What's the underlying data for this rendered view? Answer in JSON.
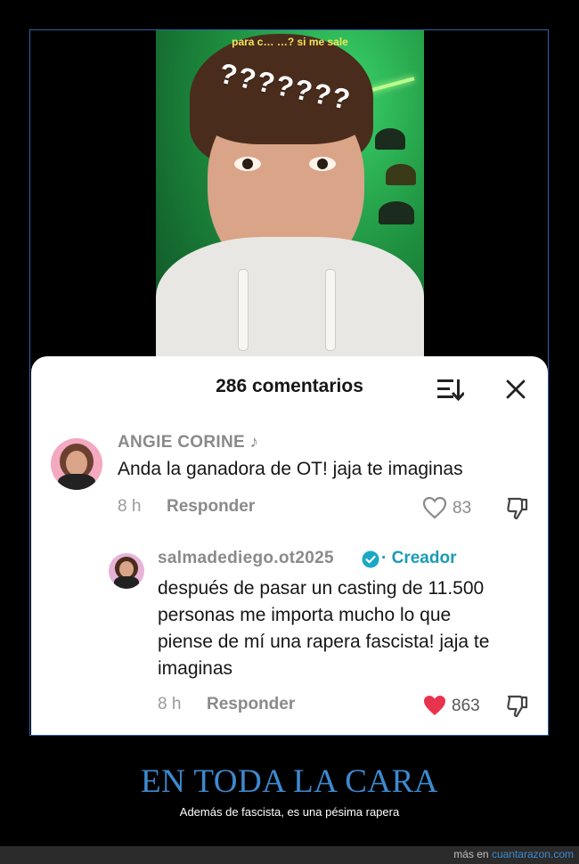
{
  "video": {
    "caption": "para c… …? si me sale",
    "overlay_text": "???????"
  },
  "comments_panel": {
    "title": "286 comentarios",
    "comments": [
      {
        "username": "ANGIE CORINE ♪",
        "text": "Anda la ganadora de OT! jaja te imaginas",
        "time": "8 h",
        "reply_label": "Responder",
        "likes": "83",
        "liked": false
      }
    ],
    "reply": {
      "username": "salmadediego.ot2025",
      "creator_label": "· Creador",
      "text_lines": [
        "después de pasar un casting de 11.500",
        "personas me importa mucho lo que",
        "piense de mí una rapera fascista! jaja te",
        "imaginas"
      ],
      "time": "8 h",
      "reply_label": "Responder",
      "likes": "863",
      "liked": true
    }
  },
  "headline": "EN TODA LA CARA",
  "subline": "Además de fascista, es una pésima rapera",
  "footer": {
    "prefix": "más en ",
    "site": "cuantarazon.com"
  },
  "colors": {
    "accent_blue": "#3d8ad0",
    "heart_red": "#e8334f",
    "verified_teal": "#1aa8c4"
  }
}
